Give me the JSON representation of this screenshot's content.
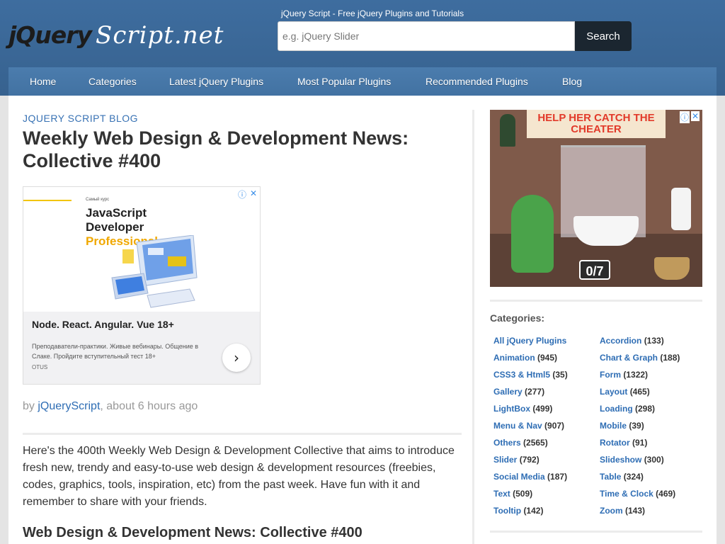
{
  "header": {
    "logo_part1": "jQuery",
    "logo_part2": "Script.net",
    "tagline": "jQuery Script - Free jQuery Plugins and Tutorials",
    "search_placeholder": "e.g. jQuery Slider",
    "search_button": "Search"
  },
  "nav": {
    "items": [
      {
        "label": "Home"
      },
      {
        "label": "Categories"
      },
      {
        "label": "Latest jQuery Plugins"
      },
      {
        "label": "Most Popular Plugins"
      },
      {
        "label": "Recommended Plugins"
      },
      {
        "label": "Blog"
      }
    ]
  },
  "article": {
    "category": "JQUERY SCRIPT BLOG",
    "title": "Weekly Web Design & Development News: Collective #400",
    "byline_prefix": "by",
    "author": "jQueryScript",
    "time": ", about 6 hours ago",
    "intro": "Here's the 400th Weekly Web Design & Development Collective that aims to introduce fresh new, trendy and easy-to-use web design & development resources (freebies, codes, graphics, tools, inspiration, etc) from the past week. Have fun with it and remember to share with your friends.",
    "subtitle": "Web Design & Development News: Collective #400"
  },
  "ad_left": {
    "small": "Самый курс",
    "heading_line1": "JavaScript",
    "heading_line2": "Developer",
    "heading_line3": "Professional",
    "headline": "Node. React. Angular. Vue 18+",
    "description": "Преподаватели-практики. Живые вебинары. Общение в Слаке. Пройдите вступительный тест 18+",
    "brand": "OTUS",
    "arrow": "›",
    "info_icon": "ⓘ",
    "close_icon": "✕"
  },
  "ad_right": {
    "sign": "HELP HER CATCH THE CHEATER",
    "counter": "0/7",
    "info_icon": "ⓘ",
    "close_icon": "✕"
  },
  "sidebar": {
    "categories_heading": "Categories:",
    "col1": [
      {
        "name": "All jQuery Plugins",
        "count": ""
      },
      {
        "name": "Animation",
        "count": "(945)"
      },
      {
        "name": "CSS3 & Html5",
        "count": "(35)"
      },
      {
        "name": "Gallery",
        "count": "(277)"
      },
      {
        "name": "LightBox",
        "count": "(499)"
      },
      {
        "name": "Menu & Nav",
        "count": "(907)"
      },
      {
        "name": "Others",
        "count": "(2565)"
      },
      {
        "name": "Slider",
        "count": "(792)"
      },
      {
        "name": "Social Media",
        "count": "(187)"
      },
      {
        "name": "Text",
        "count": "(509)"
      },
      {
        "name": "Tooltip",
        "count": "(142)"
      }
    ],
    "col2": [
      {
        "name": "Accordion",
        "count": "(133)"
      },
      {
        "name": "Chart & Graph",
        "count": "(188)"
      },
      {
        "name": "Form",
        "count": "(1322)"
      },
      {
        "name": "Layout",
        "count": "(465)"
      },
      {
        "name": "Loading",
        "count": "(298)"
      },
      {
        "name": "Mobile",
        "count": "(39)"
      },
      {
        "name": "Rotator",
        "count": "(91)"
      },
      {
        "name": "Slideshow",
        "count": "(300)"
      },
      {
        "name": "Table",
        "count": "(324)"
      },
      {
        "name": "Time & Clock",
        "count": "(469)"
      },
      {
        "name": "Zoom",
        "count": "(143)"
      }
    ]
  },
  "colors": {
    "header_bg": "#3b6797",
    "nav_bg": "#4676a6",
    "link": "#2e6db4",
    "search_button_bg": "#1b2630"
  }
}
